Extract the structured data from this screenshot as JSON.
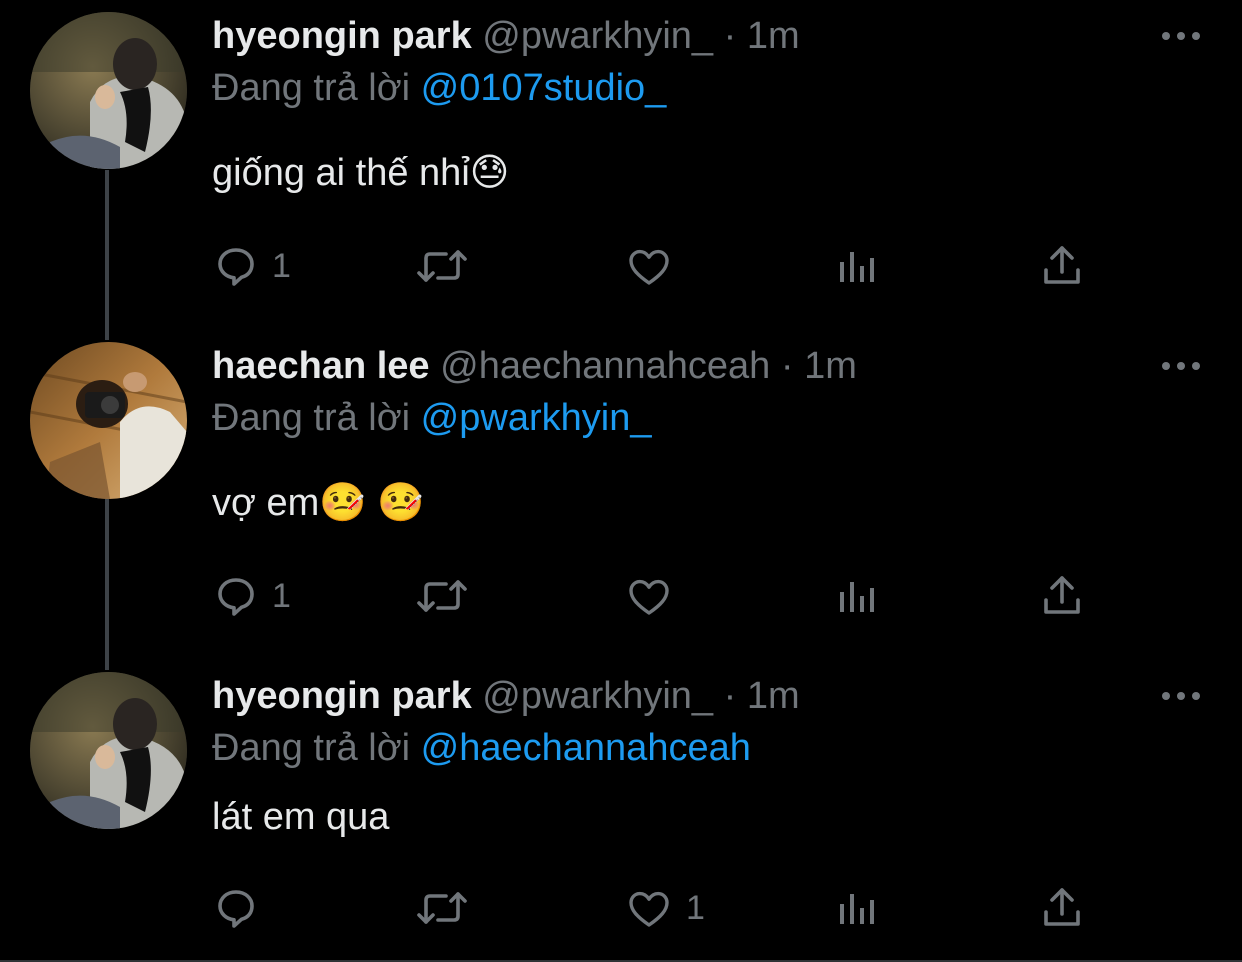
{
  "tweets": [
    {
      "display_name": "hyeongin park",
      "handle": "@pwarkhyin_",
      "separator": "·",
      "time": "1m",
      "replying_prefix": "Đang trả lời",
      "replying_to": "@0107studio_",
      "text": "giống ai thế nhỉ😓",
      "reply_count": "1",
      "retweet_count": "",
      "like_count": "",
      "liked": false
    },
    {
      "display_name": "haechan lee",
      "handle": "@haechannahceah",
      "separator": "·",
      "time": "1m",
      "replying_prefix": "Đang trả lời",
      "replying_to": "@pwarkhyin_",
      "text": "vợ em🤒 🤒",
      "reply_count": "1",
      "retweet_count": "",
      "like_count": "",
      "liked": false
    },
    {
      "display_name": "hyeongin park",
      "handle": "@pwarkhyin_",
      "separator": "·",
      "time": "1m",
      "replying_prefix": "Đang trả lời",
      "replying_to": "@haechannahceah",
      "text": "lát em qua",
      "reply_count": "",
      "retweet_count": "",
      "like_count": "1",
      "liked": false
    }
  ],
  "icons": {
    "reply": "reply-icon",
    "retweet": "retweet-icon",
    "like": "heart-icon",
    "stats": "analytics-icon",
    "share": "share-icon",
    "more": "more-icon"
  },
  "colors": {
    "background": "#000000",
    "primary_text": "#e7e9ea",
    "secondary_text": "#71767b",
    "accent": "#1d9bf0",
    "thread_line": "#3d4247"
  }
}
